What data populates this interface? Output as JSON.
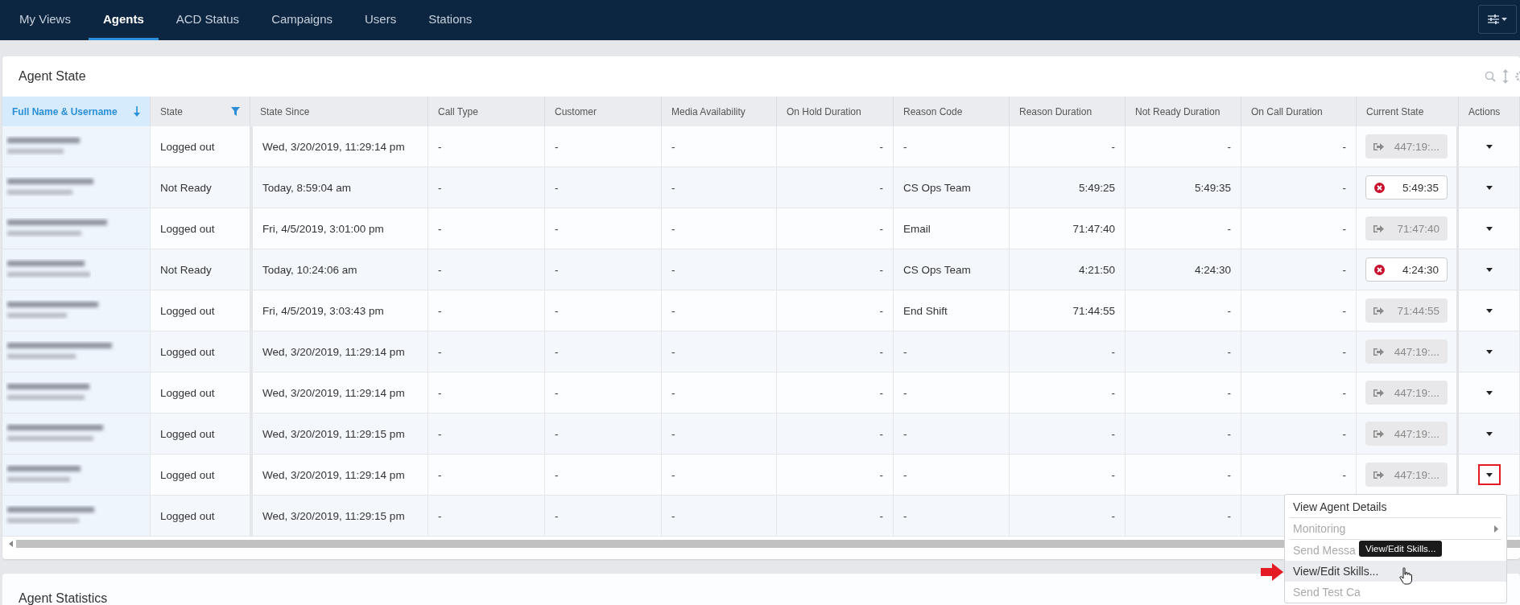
{
  "nav": {
    "tabs": [
      {
        "label": "My Views",
        "selected": false
      },
      {
        "label": "Agents",
        "selected": true
      },
      {
        "label": "ACD Status",
        "selected": false
      },
      {
        "label": "Campaigns",
        "selected": false
      },
      {
        "label": "Users",
        "selected": false
      },
      {
        "label": "Stations",
        "selected": false
      }
    ]
  },
  "agent_state": {
    "title": "Agent State",
    "columns": [
      {
        "label": "Full Name & Username",
        "selected": true,
        "sort": true,
        "filter": false
      },
      {
        "label": "State",
        "selected": false,
        "sort": false,
        "filter": true
      },
      {
        "label": "State Since",
        "selected": false,
        "sort": false,
        "filter": false
      },
      {
        "label": "Call Type",
        "selected": false,
        "sort": false,
        "filter": false
      },
      {
        "label": "Customer",
        "selected": false,
        "sort": false,
        "filter": false
      },
      {
        "label": "Media Availability",
        "selected": false,
        "sort": false,
        "filter": false
      },
      {
        "label": "On Hold Duration",
        "selected": false,
        "sort": false,
        "filter": false
      },
      {
        "label": "Reason Code",
        "selected": false,
        "sort": false,
        "filter": false
      },
      {
        "label": "Reason Duration",
        "selected": false,
        "sort": false,
        "filter": false
      },
      {
        "label": "Not Ready Duration",
        "selected": false,
        "sort": false,
        "filter": false
      },
      {
        "label": "On Call Duration",
        "selected": false,
        "sort": false,
        "filter": false
      },
      {
        "label": "Current State",
        "selected": false,
        "sort": false,
        "filter": false
      },
      {
        "label": "Actions",
        "selected": false,
        "sort": false,
        "filter": false
      }
    ],
    "rows": [
      {
        "state": "Logged out",
        "state_since": "Wed, 3/20/2019, 11:29:14 pm",
        "call_type": "-",
        "customer": "-",
        "media_availability": "-",
        "on_hold_duration": "-",
        "reason_code": "-",
        "reason_duration": "-",
        "not_ready_duration": "-",
        "on_call_duration": "-",
        "current_state": {
          "kind": "logged_out",
          "text": "447:19:..."
        },
        "highlighted": false
      },
      {
        "state": "Not Ready",
        "state_since": "Today, 8:59:04 am",
        "call_type": "-",
        "customer": "-",
        "media_availability": "-",
        "on_hold_duration": "-",
        "reason_code": "CS Ops Team",
        "reason_duration": "5:49:25",
        "not_ready_duration": "5:49:35",
        "on_call_duration": "-",
        "current_state": {
          "kind": "not_ready",
          "text": "5:49:35"
        },
        "highlighted": false
      },
      {
        "state": "Logged out",
        "state_since": "Fri, 4/5/2019, 3:01:00 pm",
        "call_type": "-",
        "customer": "-",
        "media_availability": "-",
        "on_hold_duration": "-",
        "reason_code": "Email",
        "reason_duration": "71:47:40",
        "not_ready_duration": "-",
        "on_call_duration": "-",
        "current_state": {
          "kind": "logged_out",
          "text": "71:47:40"
        },
        "highlighted": false
      },
      {
        "state": "Not Ready",
        "state_since": "Today, 10:24:06 am",
        "call_type": "-",
        "customer": "-",
        "media_availability": "-",
        "on_hold_duration": "-",
        "reason_code": "CS Ops Team",
        "reason_duration": "4:21:50",
        "not_ready_duration": "4:24:30",
        "on_call_duration": "-",
        "current_state": {
          "kind": "not_ready",
          "text": "4:24:30"
        },
        "highlighted": false
      },
      {
        "state": "Logged out",
        "state_since": "Fri, 4/5/2019, 3:03:43 pm",
        "call_type": "-",
        "customer": "-",
        "media_availability": "-",
        "on_hold_duration": "-",
        "reason_code": "End Shift",
        "reason_duration": "71:44:55",
        "not_ready_duration": "-",
        "on_call_duration": "-",
        "current_state": {
          "kind": "logged_out",
          "text": "71:44:55"
        },
        "highlighted": false
      },
      {
        "state": "Logged out",
        "state_since": "Wed, 3/20/2019, 11:29:14 pm",
        "call_type": "-",
        "customer": "-",
        "media_availability": "-",
        "on_hold_duration": "-",
        "reason_code": "-",
        "reason_duration": "-",
        "not_ready_duration": "-",
        "on_call_duration": "-",
        "current_state": {
          "kind": "logged_out",
          "text": "447:19:..."
        },
        "highlighted": false
      },
      {
        "state": "Logged out",
        "state_since": "Wed, 3/20/2019, 11:29:14 pm",
        "call_type": "-",
        "customer": "-",
        "media_availability": "-",
        "on_hold_duration": "-",
        "reason_code": "-",
        "reason_duration": "-",
        "not_ready_duration": "-",
        "on_call_duration": "-",
        "current_state": {
          "kind": "logged_out",
          "text": "447:19:..."
        },
        "highlighted": false
      },
      {
        "state": "Logged out",
        "state_since": "Wed, 3/20/2019, 11:29:15 pm",
        "call_type": "-",
        "customer": "-",
        "media_availability": "-",
        "on_hold_duration": "-",
        "reason_code": "-",
        "reason_duration": "-",
        "not_ready_duration": "-",
        "on_call_duration": "-",
        "current_state": {
          "kind": "logged_out",
          "text": "447:19:..."
        },
        "highlighted": false
      },
      {
        "state": "Logged out",
        "state_since": "Wed, 3/20/2019, 11:29:14 pm",
        "call_type": "-",
        "customer": "-",
        "media_availability": "-",
        "on_hold_duration": "-",
        "reason_code": "-",
        "reason_duration": "-",
        "not_ready_duration": "-",
        "on_call_duration": "-",
        "current_state": {
          "kind": "logged_out",
          "text": "447:19:..."
        },
        "highlighted": true
      },
      {
        "state": "Logged out",
        "state_since": "Wed, 3/20/2019, 11:29:15 pm",
        "call_type": "-",
        "customer": "-",
        "media_availability": "-",
        "on_hold_duration": "-",
        "reason_code": "-",
        "reason_duration": "-",
        "not_ready_duration": "-"
      }
    ]
  },
  "actions_menu": {
    "items": [
      {
        "label": "View Agent Details",
        "disabled": false,
        "selected": false,
        "submenu": false,
        "divider_after": true
      },
      {
        "label": "Monitoring",
        "disabled": true,
        "selected": false,
        "submenu": true,
        "divider_after": true
      },
      {
        "label": "Send Messa",
        "disabled": true,
        "selected": false,
        "submenu": false,
        "divider_after": false
      },
      {
        "label": "View/Edit Skills...",
        "disabled": false,
        "selected": true,
        "submenu": false,
        "divider_after": false
      },
      {
        "label": "Send Test Ca",
        "disabled": true,
        "selected": false,
        "submenu": false,
        "divider_after": false
      }
    ],
    "tooltip": "View/Edit Skills..."
  },
  "agent_statistics": {
    "title": "Agent Statistics"
  }
}
